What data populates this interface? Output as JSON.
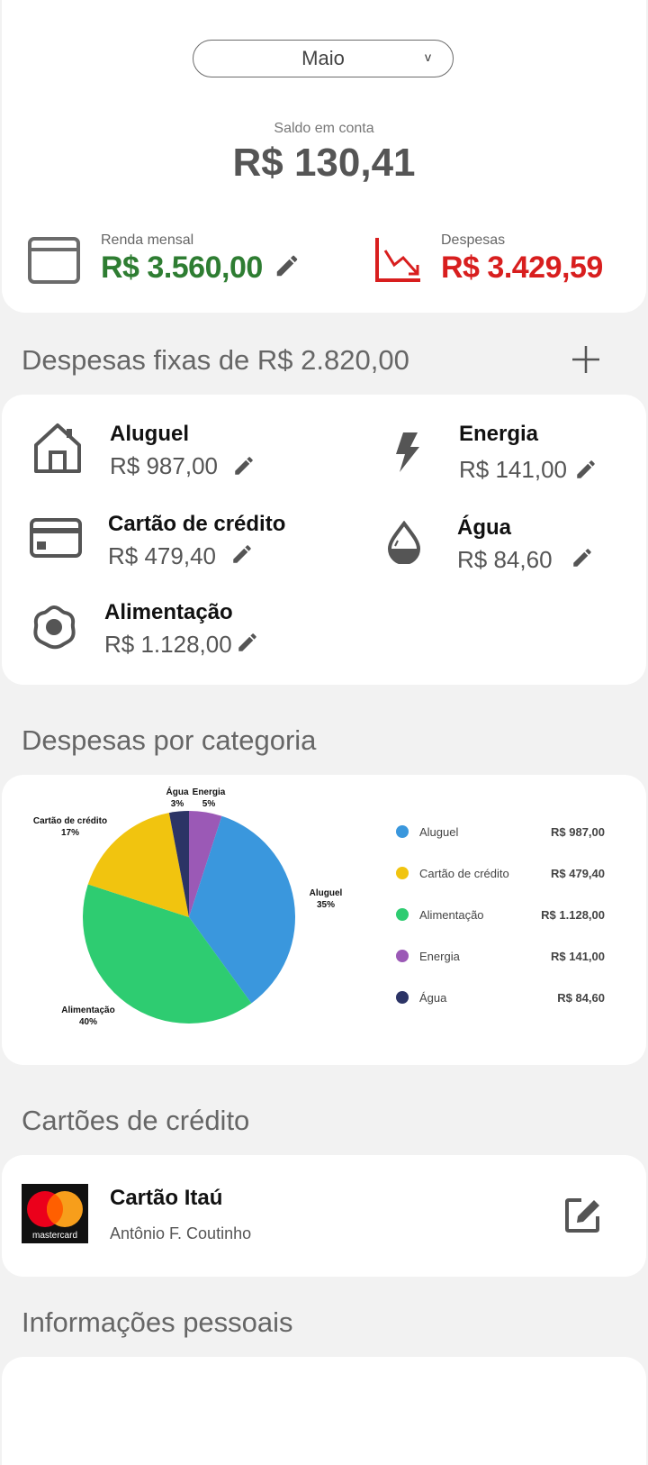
{
  "header": {
    "month": "Maio",
    "month_chevron": "v",
    "balance_label": "Saldo em conta",
    "balance_value": "R$ 130,41"
  },
  "income": {
    "label": "Renda mensal",
    "value": "R$ 3.560,00",
    "icon": "wallet-icon",
    "color": "#2e7d32"
  },
  "expenses": {
    "label": "Despesas",
    "value": "R$ 3.429,59",
    "icon": "trending-down-icon",
    "color": "#d81e1e"
  },
  "fixed": {
    "title": "Despesas fixas de R$ 2.820,00",
    "items": [
      {
        "name": "Aluguel",
        "value": "R$ 987,00",
        "icon": "house-icon"
      },
      {
        "name": "Energia",
        "value": "R$ 141,00",
        "icon": "lightning-icon"
      },
      {
        "name": "Cartão de crédito",
        "value": "R$ 479,40",
        "icon": "credit-card-icon"
      },
      {
        "name": "Água",
        "value": "R$ 84,60",
        "icon": "water-drop-icon"
      },
      {
        "name": "Alimentação",
        "value": "R$ 1.128,00",
        "icon": "food-icon"
      }
    ]
  },
  "category": {
    "title": "Despesas por categoria",
    "legend": [
      {
        "name": "Aluguel",
        "value": "R$ 987,00",
        "color": "#3a97dd"
      },
      {
        "name": "Cartão de crédito",
        "value": "R$ 479,40",
        "color": "#f1c40f"
      },
      {
        "name": "Alimentação",
        "value": "R$ 1.128,00",
        "color": "#2ecc71"
      },
      {
        "name": "Energia",
        "value": "R$ 141,00",
        "color": "#9b59b6"
      },
      {
        "name": "Água",
        "value": "R$ 84,60",
        "color": "#2c3466"
      }
    ],
    "pie_labels": [
      {
        "name": "Aluguel",
        "pct": "35%"
      },
      {
        "name": "Cartão de crédito",
        "pct": "17%"
      },
      {
        "name": "Alimentação",
        "pct": "40%"
      },
      {
        "name": "Energia",
        "pct": "5%"
      },
      {
        "name": "Água",
        "pct": "3%"
      }
    ]
  },
  "chart_data": {
    "type": "pie",
    "categories": [
      "Aluguel",
      "Cartão de crédito",
      "Alimentação",
      "Energia",
      "Água"
    ],
    "values": [
      987.0,
      479.4,
      1128.0,
      141.0,
      84.6
    ],
    "percent_labels": [
      "35%",
      "17%",
      "40%",
      "5%",
      "3%"
    ],
    "colors": [
      "#3a97dd",
      "#f1c40f",
      "#2ecc71",
      "#9b59b6",
      "#2c3466"
    ],
    "order_clockwise_from_top": [
      "Energia",
      "Aluguel",
      "Alimentação",
      "Cartão de crédito",
      "Água"
    ]
  },
  "cards": {
    "title": "Cartões de crédito",
    "items": [
      {
        "name": "Cartão Itaú",
        "holder": "Antônio F. Coutinho",
        "brand": "mastercard"
      }
    ]
  },
  "personal": {
    "title": "Informações pessoais"
  }
}
